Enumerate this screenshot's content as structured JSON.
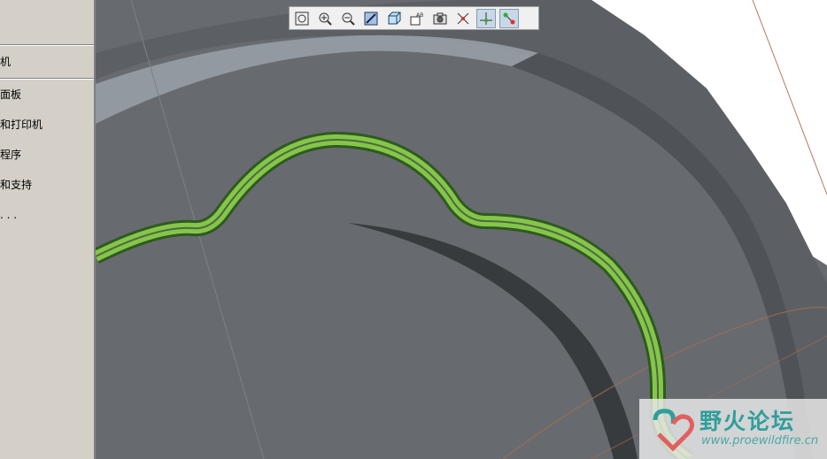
{
  "left_menu": {
    "items": [
      {
        "label": "机"
      },
      {
        "label": "面板"
      },
      {
        "label": "和打印机"
      },
      {
        "label": "程序"
      },
      {
        "label": "和支持"
      },
      {
        "label": ". . ."
      }
    ]
  },
  "toolbar": {
    "buttons": [
      {
        "icon": "zoom-fit-icon",
        "active": false
      },
      {
        "icon": "zoom-in-icon",
        "active": false
      },
      {
        "icon": "zoom-out-icon",
        "active": false
      },
      {
        "icon": "repaint-icon",
        "active": false
      },
      {
        "icon": "display-style-icon",
        "active": false
      },
      {
        "icon": "saved-views-icon",
        "active": false
      },
      {
        "icon": "camera-icon",
        "active": false
      },
      {
        "icon": "datum-display-icon",
        "active": false
      },
      {
        "icon": "axis-display-icon",
        "active": true
      },
      {
        "icon": "point-display-icon",
        "active": true
      }
    ]
  },
  "watermark": {
    "title": "野火论坛",
    "url": "www.proewildfire.cn"
  },
  "colors": {
    "background": "#676b70",
    "highlight_green": "#8fd14f",
    "panel": "#d4d0c8"
  }
}
